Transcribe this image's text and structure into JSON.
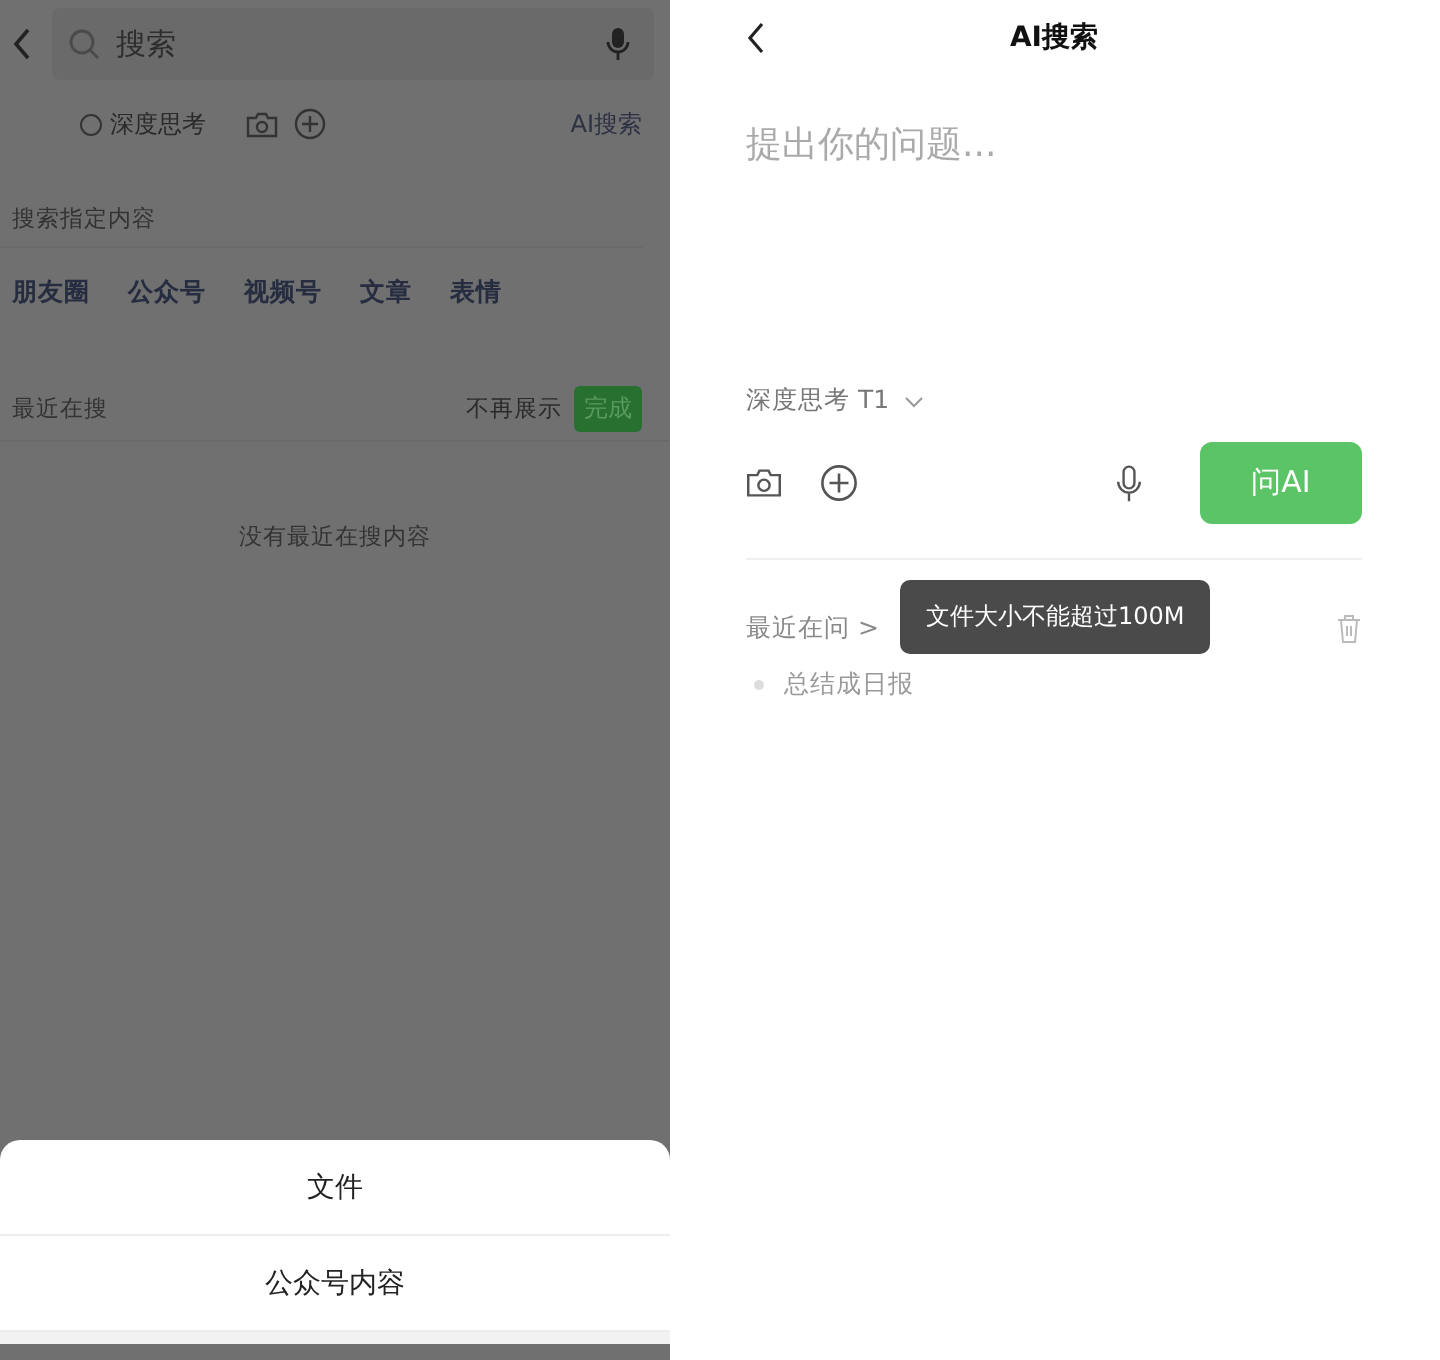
{
  "left_screen": {
    "search": {
      "placeholder": "搜索"
    },
    "deep_think": {
      "label": "深度思考",
      "checked": false
    },
    "ai_search_link": "AI搜索",
    "section_title": "搜索指定内容",
    "categories": [
      "朋友圈",
      "公众号",
      "视频号",
      "文章",
      "表情"
    ],
    "recent": {
      "title": "最近在搜",
      "hide": "不再展示",
      "done": "完成",
      "empty": "没有最近在搜内容"
    },
    "sheet_options": [
      "文件",
      "公众号内容"
    ]
  },
  "right_screen": {
    "title": "AI搜索",
    "question": {
      "placeholder": "提出你的问题..."
    },
    "model": "深度思考 T1",
    "ask_button": "问AI",
    "recent": {
      "title": "最近在问 >",
      "items": [
        "总结成日报"
      ]
    },
    "toast": "文件大小不能超过100M"
  }
}
